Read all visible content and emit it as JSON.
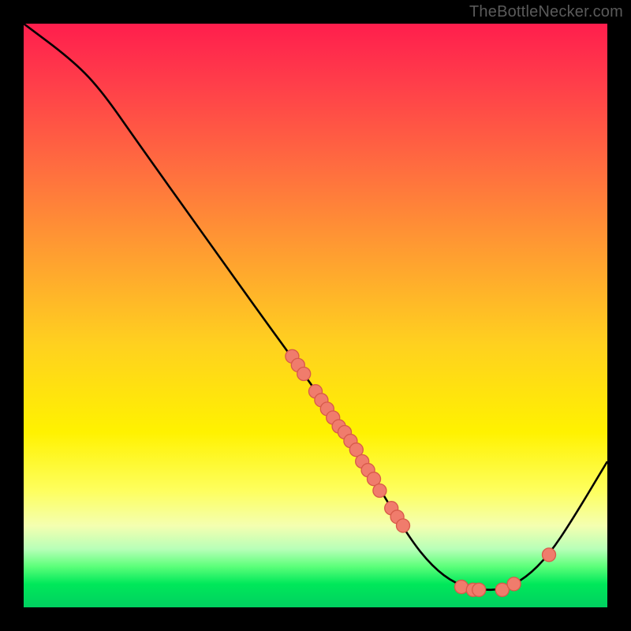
{
  "watermark": "TheBottleNecker.com",
  "colors": {
    "frame": "#000000",
    "curve": "#000000",
    "marker_fill": "#f07c6c",
    "marker_stroke": "#d85a4a"
  },
  "chart_data": {
    "type": "line",
    "title": "",
    "xlabel": "",
    "ylabel": "",
    "xlim": [
      0,
      100
    ],
    "ylim": [
      0,
      100
    ],
    "curve": [
      {
        "x": 0,
        "y": 100
      },
      {
        "x": 8,
        "y": 94
      },
      {
        "x": 13,
        "y": 89
      },
      {
        "x": 20,
        "y": 79
      },
      {
        "x": 30,
        "y": 65
      },
      {
        "x": 40,
        "y": 51
      },
      {
        "x": 48,
        "y": 40
      },
      {
        "x": 55,
        "y": 30
      },
      {
        "x": 60,
        "y": 22
      },
      {
        "x": 66,
        "y": 12
      },
      {
        "x": 70,
        "y": 7
      },
      {
        "x": 74,
        "y": 4
      },
      {
        "x": 78,
        "y": 3
      },
      {
        "x": 82,
        "y": 3
      },
      {
        "x": 86,
        "y": 5
      },
      {
        "x": 90,
        "y": 9
      },
      {
        "x": 94,
        "y": 15
      },
      {
        "x": 100,
        "y": 25
      }
    ],
    "markers": [
      {
        "x": 46,
        "y": 43
      },
      {
        "x": 47,
        "y": 41.5
      },
      {
        "x": 48,
        "y": 40
      },
      {
        "x": 50,
        "y": 37
      },
      {
        "x": 51,
        "y": 35.5
      },
      {
        "x": 52,
        "y": 34
      },
      {
        "x": 53,
        "y": 32.5
      },
      {
        "x": 54,
        "y": 31
      },
      {
        "x": 55,
        "y": 30
      },
      {
        "x": 56,
        "y": 28.5
      },
      {
        "x": 57,
        "y": 27
      },
      {
        "x": 58,
        "y": 25
      },
      {
        "x": 59,
        "y": 23.5
      },
      {
        "x": 60,
        "y": 22
      },
      {
        "x": 61,
        "y": 20
      },
      {
        "x": 63,
        "y": 17
      },
      {
        "x": 64,
        "y": 15.5
      },
      {
        "x": 65,
        "y": 14
      },
      {
        "x": 75,
        "y": 3.5
      },
      {
        "x": 77,
        "y": 3
      },
      {
        "x": 78,
        "y": 3
      },
      {
        "x": 82,
        "y": 3
      },
      {
        "x": 84,
        "y": 4
      },
      {
        "x": 90,
        "y": 9
      }
    ]
  }
}
